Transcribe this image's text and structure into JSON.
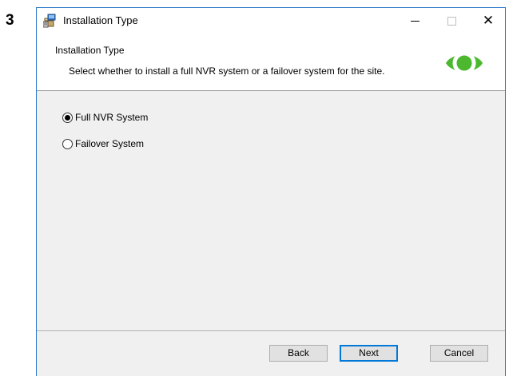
{
  "step_number": "3",
  "window": {
    "title": "Installation Type",
    "icon": "installer-package-icon"
  },
  "title_buttons": {
    "minimize_icon": "minimize-icon",
    "maximize_icon": "maximize-icon",
    "close_icon": "close-icon",
    "close_glyph": "✕"
  },
  "header": {
    "title": "Installation Type",
    "description": "Select whether to install a full NVR system or a failover system for the site.",
    "logo_icon": "eye-logo-icon",
    "logo_color": "#4cb82f"
  },
  "options": [
    {
      "label": "Full NVR System",
      "selected": true
    },
    {
      "label": "Failover System",
      "selected": false
    }
  ],
  "buttons": {
    "back": "Back",
    "next": "Next",
    "cancel": "Cancel"
  },
  "colors": {
    "window_border": "#2b79c9",
    "default_button_border": "#0078d7",
    "dialog_background": "#f0f0f0"
  }
}
